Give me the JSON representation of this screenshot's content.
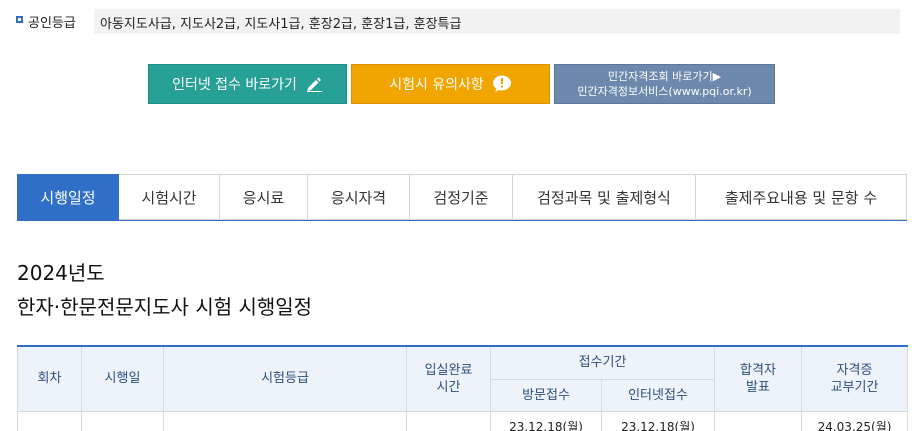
{
  "grade": {
    "label": "공인등급",
    "value": "아동지도사급, 지도사2급, 지도사1급, 훈장2급, 훈장1급, 훈장특급"
  },
  "buttons": {
    "internet": "인터넷 접수 바로가기",
    "notice": "시험시 유의사항",
    "private_line1": "민간자격조회 바로가기▶",
    "private_line2": "민간자격정보서비스(www.pqi.or.kr)"
  },
  "tabs": [
    {
      "label": "시행일정",
      "active": true
    },
    {
      "label": "시험시간",
      "active": false
    },
    {
      "label": "응시료",
      "active": false
    },
    {
      "label": "응시자격",
      "active": false
    },
    {
      "label": "검정기준",
      "active": false
    },
    {
      "label": "검정과목 및 출제형식",
      "active": false
    },
    {
      "label": "출제주요내용 및 문항 수",
      "active": false
    }
  ],
  "heading": {
    "year": "2024년도",
    "title": "한자·한문전문지도사 시험 시행일정"
  },
  "table": {
    "headers": {
      "round": "회차",
      "date": "시행일",
      "grade": "시험등급",
      "entry": "입실완료\n시간",
      "period": "접수기간",
      "visit": "방문접수",
      "online": "인터넷접수",
      "pass_line1": "합격자",
      "pass_line2": "발표",
      "cert_line1": "자격증",
      "cert_line2": "교부기간"
    },
    "first_row_partial": {
      "visit": "23.12.18(월)",
      "online": "23.12.18(월)",
      "cert": "24.03.25(월)"
    }
  },
  "colors": {
    "accent": "#2f6fc7",
    "internet_btn": "#27a195",
    "notice_btn": "#f0a500",
    "private_btn": "#6c89ad"
  }
}
